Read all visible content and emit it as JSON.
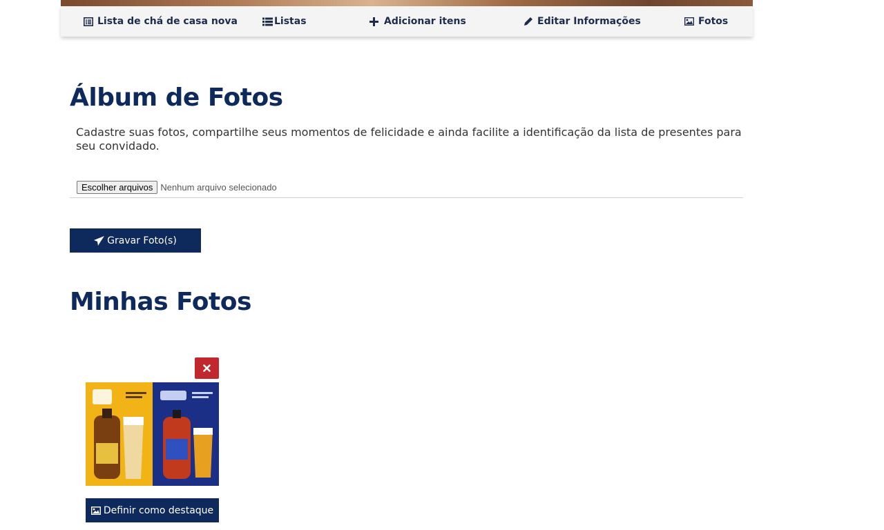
{
  "nav": {
    "items": [
      {
        "label": "Lista de chá de casa nova",
        "icon": "list-alt-icon"
      },
      {
        "label": "Listas",
        "icon": "list-icon"
      },
      {
        "label": "Adicionar itens",
        "icon": "plus-icon"
      },
      {
        "label": "Editar Informações",
        "icon": "pencil-icon"
      },
      {
        "label": "Fotos",
        "icon": "picture-icon"
      }
    ]
  },
  "album": {
    "title": "Álbum de Fotos",
    "description": "Cadastre suas fotos, compartilhe seus momentos de felicidade e ainda facilite a identificação da lista de presentes para seu convidado.",
    "file_button": "Escolher arquivos",
    "file_status": "Nenhum arquivo selecionado",
    "save_button": "Gravar Foto(s)"
  },
  "my_photos": {
    "title": "Minhas Fotos",
    "photos": [
      {
        "feature_button": "Definir como destaque",
        "delete_icon": "times-icon",
        "colors": {
          "left_panel": "#f2b316",
          "right_panel": "#1c2f86"
        }
      }
    ]
  },
  "colors": {
    "brand": "#0e2a5c",
    "danger": "#c0282d",
    "nav_bg": "#f4f4f4"
  }
}
